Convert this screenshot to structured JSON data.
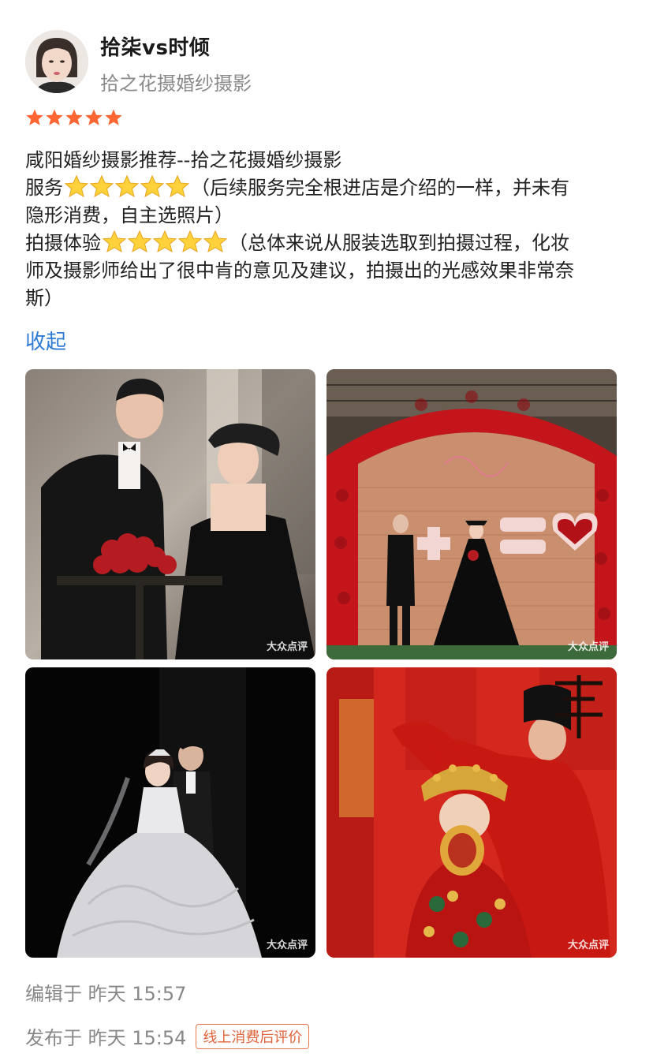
{
  "header": {
    "user_name": "拾柒vs时倾",
    "shop_name": "拾之花摄婚纱摄影"
  },
  "rating": {
    "stars": 5,
    "star_color": "#ff6633"
  },
  "review": {
    "title": "咸阳婚纱摄影推荐--拾之花摄婚纱摄影",
    "service_label": "服务",
    "service_comment_1": "（后续服务完全根进店是介绍的一样，并未有",
    "service_comment_2": "隐形消费，自主选照片）",
    "experience_label": "拍摄体验",
    "experience_comment_1": "（总体来说从服装选取到拍摄过程，化妆",
    "experience_comment_2": "师及摄影师给出了很中肯的意见及建议，拍摄出的光感效果非常奈",
    "experience_comment_3": "斯）"
  },
  "collapse_label": "收起",
  "photos": [
    {
      "name": "photo-couple-roses",
      "watermark": "大众点评"
    },
    {
      "name": "photo-rose-arch",
      "watermark": "大众点评"
    },
    {
      "name": "photo-white-gown",
      "watermark": "大众点评"
    },
    {
      "name": "photo-chinese-wedding",
      "watermark": "大众点评"
    }
  ],
  "meta": {
    "edited": "编辑于  昨天 15:57",
    "published": "发布于  昨天 15:54",
    "badge": "线上消费后评价"
  }
}
